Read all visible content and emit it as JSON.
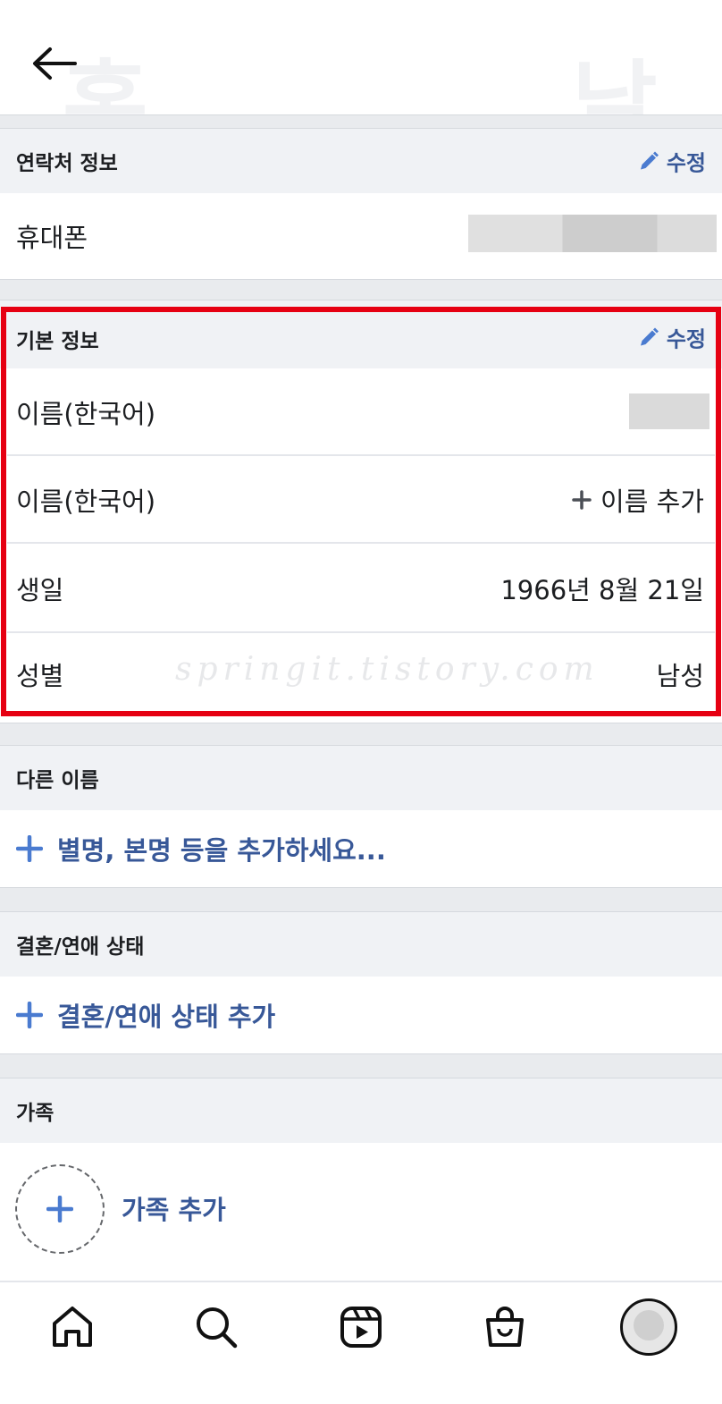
{
  "header": {
    "ghost_left": "홈",
    "ghost_right": "날"
  },
  "contact": {
    "title": "연락처 정보",
    "edit_label": "수정",
    "rows": [
      {
        "label": "휴대폰"
      }
    ]
  },
  "basic": {
    "title": "기본 정보",
    "edit_label": "수정",
    "rows": [
      {
        "label": "이름(한국어)",
        "value": ""
      },
      {
        "label": "이름(한국어)",
        "value": "이름 추가"
      },
      {
        "label": "생일",
        "value": "1966년 8월 21일"
      },
      {
        "label": "성별",
        "value": "남성"
      }
    ]
  },
  "other_names": {
    "title": "다른 이름",
    "add_label": "별명, 본명 등을 추가하세요..."
  },
  "relationship": {
    "title": "결혼/연애 상태",
    "add_label": "결혼/연애 상태 추가"
  },
  "family": {
    "title": "가족",
    "add_label": "가족 추가"
  },
  "watermark": "springit.tistory.com",
  "colors": {
    "accent": "#385898",
    "icon_blue": "#4a7bd0",
    "highlight": "#e60012",
    "section_bg": "#f0f2f5"
  },
  "icons": {
    "back": "arrow-left-icon",
    "edit": "pencil-icon",
    "add": "plus-icon",
    "nav": [
      "home-icon",
      "search-icon",
      "reels-icon",
      "shop-icon",
      "profile-avatar"
    ]
  }
}
